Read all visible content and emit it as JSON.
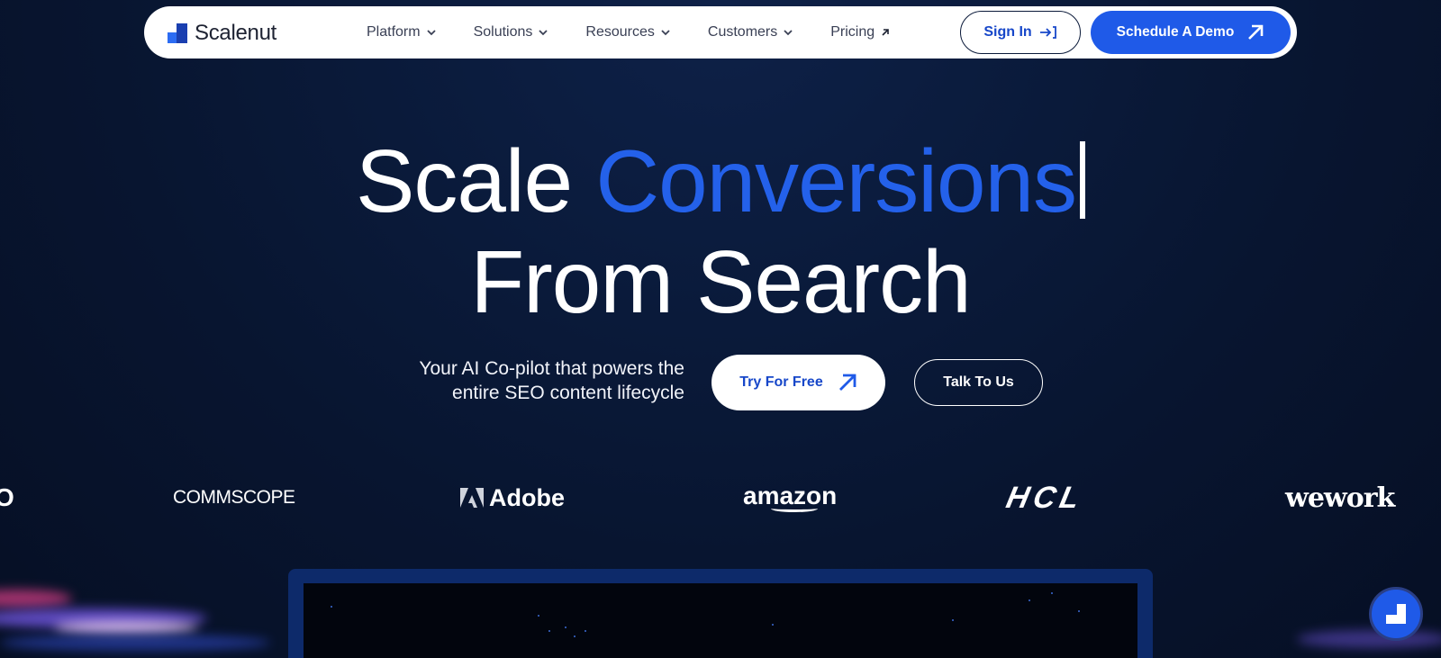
{
  "brand": {
    "name": "Scalenut",
    "accent_color": "#1f5ae8"
  },
  "nav": {
    "items": [
      {
        "label": "Platform",
        "icon": "chevron-down-icon"
      },
      {
        "label": "Solutions",
        "icon": "chevron-down-icon"
      },
      {
        "label": "Resources",
        "icon": "chevron-down-icon"
      },
      {
        "label": "Customers",
        "icon": "chevron-down-icon"
      },
      {
        "label": "Pricing",
        "icon": "arrow-up-right-icon"
      }
    ],
    "signin_label": "Sign In",
    "demo_label": "Schedule A Demo"
  },
  "hero": {
    "headline_word1": "Scale",
    "headline_accent": "Conversions",
    "headline_line2": "From Search",
    "tagline_line1": "Your AI Co-pilot that powers the",
    "tagline_line2": "entire SEO content lifecycle",
    "cta_primary": "Try For Free",
    "cta_secondary": "Talk To Us"
  },
  "customer_logos": [
    "O",
    "COMMSCOPE",
    "Adobe",
    "amazon",
    "HCL",
    "wework"
  ]
}
